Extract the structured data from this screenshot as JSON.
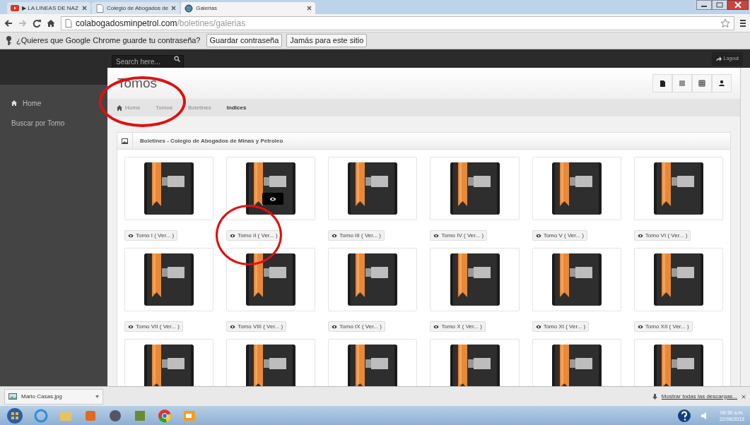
{
  "browser": {
    "tabs": [
      {
        "label": "▶ LA LINEAS DE NAZ",
        "selected": false
      },
      {
        "label": "Colegio de Abogados de",
        "selected": false
      },
      {
        "label": "Galerias",
        "selected": true
      }
    ],
    "url_host": "colabogadosminpetrol.com",
    "url_path": "/boletines/galerias"
  },
  "infobar": {
    "message": "¿Quieres que Google Chrome guarde tu contraseña?",
    "buttons": [
      "Guardar contraseña",
      "Jamás para este sitio"
    ]
  },
  "navbar": {
    "search": {
      "placeholder": "Search here..."
    },
    "logout": "Logout"
  },
  "sidebar": {
    "items": [
      {
        "label": "Home",
        "kind": "home"
      },
      {
        "label": "Buscar por Tomo",
        "kind": "plain"
      }
    ]
  },
  "page": {
    "title": "Tomos",
    "breadcrumb": [
      {
        "label": "Home",
        "current": false
      },
      {
        "label": "Tomos",
        "current": false
      },
      {
        "label": "Boletines",
        "current": false
      },
      {
        "label": "Indices",
        "current": true
      }
    ]
  },
  "panel": {
    "title": "Boletines - Colegio de Abogados de Minas y Petroleo",
    "items": [
      {
        "label": "Tomo I ( Ver... )",
        "hovered": false
      },
      {
        "label": "Tomo II ( Ver... )",
        "hovered": true
      },
      {
        "label": "Tomo III ( Ver... )",
        "hovered": false
      },
      {
        "label": "Tomo IV ( Ver... )",
        "hovered": false
      },
      {
        "label": "Tomo V ( Ver... )",
        "hovered": false
      },
      {
        "label": "Tomo VI ( Ver... )",
        "hovered": false
      },
      {
        "label": "Tomo VII ( Ver... )",
        "hovered": false
      },
      {
        "label": "Tomo VIII ( Ver... )",
        "hovered": false
      },
      {
        "label": "Tomo IX ( Ver... )",
        "hovered": false
      },
      {
        "label": "Tomo X ( Ver... )",
        "hovered": false
      },
      {
        "label": "Tomo XI ( Ver... )",
        "hovered": false
      },
      {
        "label": "Tomo XII ( Ver... )",
        "hovered": false
      }
    ]
  },
  "downloads": {
    "file": "Mario Casas.jpg",
    "show_all": "Mostrar todas las descargas..."
  },
  "taskbar": {
    "time": "09:30 a.m.",
    "date": "22/06/2013"
  }
}
